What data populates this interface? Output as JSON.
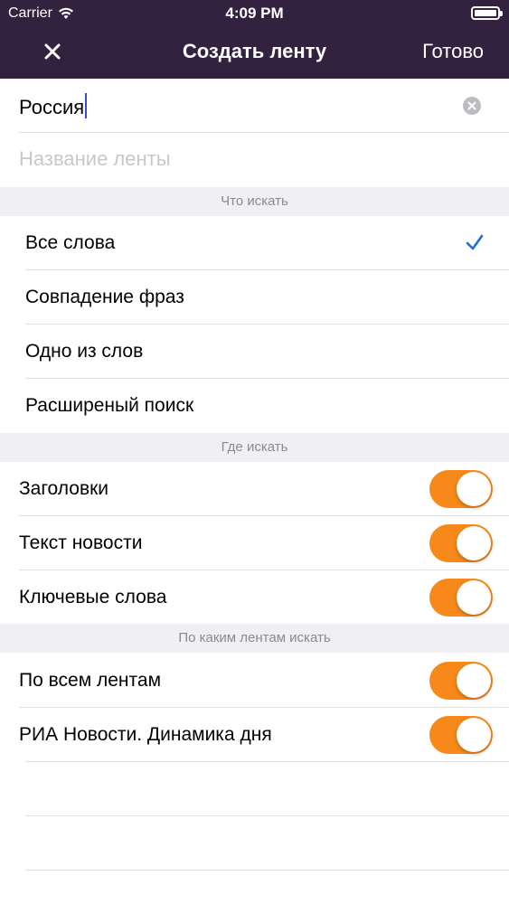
{
  "status_bar": {
    "carrier": "Carrier",
    "time": "4:09 PM"
  },
  "nav": {
    "close_label": "✕",
    "title": "Создать ленту",
    "done_label": "Готово"
  },
  "form": {
    "query_value": "Россия",
    "feed_name_placeholder": "Название ленты"
  },
  "sections": {
    "what": {
      "header": "Что искать",
      "options": [
        {
          "label": "Все слова",
          "selected": true
        },
        {
          "label": "Совпадение фраз",
          "selected": false
        },
        {
          "label": "Одно из слов",
          "selected": false
        },
        {
          "label": "Расширеный поиск",
          "selected": false
        }
      ]
    },
    "where": {
      "header": "Где искать",
      "toggles": [
        {
          "label": "Заголовки",
          "on": true
        },
        {
          "label": "Текст новости",
          "on": true
        },
        {
          "label": "Ключевые слова",
          "on": true
        }
      ]
    },
    "feeds": {
      "header": "По каким лентам искать",
      "toggles": [
        {
          "label": "По всем лентам",
          "on": true
        },
        {
          "label": "РИА Новости. Динамика дня",
          "on": true
        }
      ]
    }
  },
  "colors": {
    "nav_background": "#33223f",
    "accent": "#f7891a",
    "checkmark": "#1f6fd0",
    "section_background": "#efeff4"
  }
}
